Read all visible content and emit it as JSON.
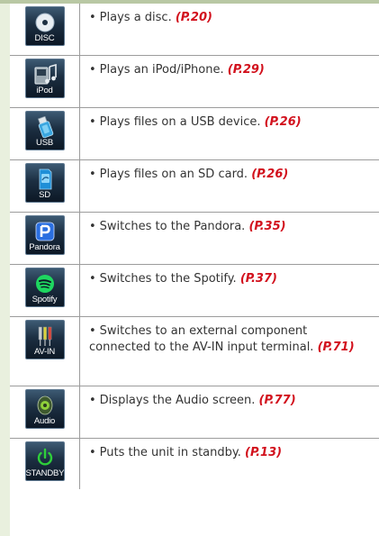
{
  "rows": [
    {
      "icon": "disc-icon",
      "icon_label": "DISC",
      "bullet": "•",
      "text": "Plays a disc.",
      "page_ref": "(P.20)"
    },
    {
      "icon": "ipod-icon",
      "icon_label": "iPod",
      "bullet": "•",
      "text": "Plays an iPod/iPhone.",
      "page_ref": "(P.29)"
    },
    {
      "icon": "usb-icon",
      "icon_label": "USB",
      "bullet": "•",
      "text": "Plays files on a USB device.",
      "page_ref": "(P.26)"
    },
    {
      "icon": "sd-card-icon",
      "icon_label": "SD",
      "bullet": "•",
      "text": "Plays files on an SD card.",
      "page_ref": "(P.26)"
    },
    {
      "icon": "pandora-icon",
      "icon_label": "Pandora",
      "bullet": "•",
      "text": "Switches to the Pandora.",
      "page_ref": "(P.35)"
    },
    {
      "icon": "spotify-icon",
      "icon_label": "Spotify",
      "bullet": "•",
      "text": "Switches to the Spotify.",
      "page_ref": "(P.37)"
    },
    {
      "icon": "av-in-icon",
      "icon_label": "AV-IN",
      "bullet": "•",
      "text": "Switches to an external component connected to the AV-IN input terminal.",
      "page_ref": "(P.71)"
    },
    {
      "icon": "audio-icon",
      "icon_label": "Audio",
      "bullet": "•",
      "text": "Displays the Audio screen.",
      "page_ref": "(P.77)"
    },
    {
      "icon": "standby-icon",
      "icon_label": "STANDBY",
      "bullet": "•",
      "text": "Puts the unit in standby.",
      "page_ref": "(P.13)"
    }
  ],
  "colors": {
    "page_ref": "#d2111d",
    "band": "#b9c8a4",
    "strip": "#e9f0de"
  }
}
